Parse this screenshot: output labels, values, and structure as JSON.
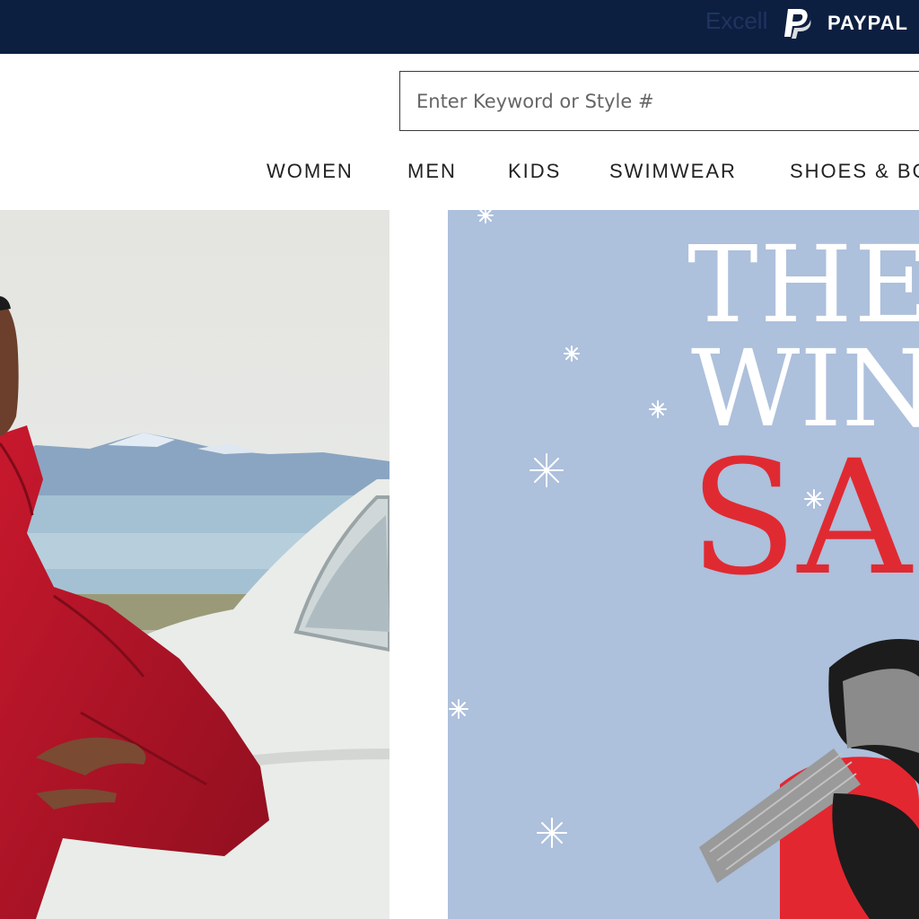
{
  "topbar": {
    "promo_text": "Excell",
    "paypal_label": "PAYPAL",
    "background": "#0d1f40"
  },
  "search": {
    "placeholder": "Enter Keyword or Style #"
  },
  "nav": {
    "items": [
      {
        "label": "WOMEN"
      },
      {
        "label": "MEN"
      },
      {
        "label": "KIDS"
      },
      {
        "label": "SWIMWEAR"
      },
      {
        "label": "SHOES & BO"
      }
    ]
  },
  "hero_right": {
    "line1": "THE",
    "line2": "WIN",
    "line3": "SA",
    "background": "#adc0dc",
    "accent": "#e02a32"
  },
  "icons": [
    "paypal-icon",
    "snowflake-icon"
  ]
}
